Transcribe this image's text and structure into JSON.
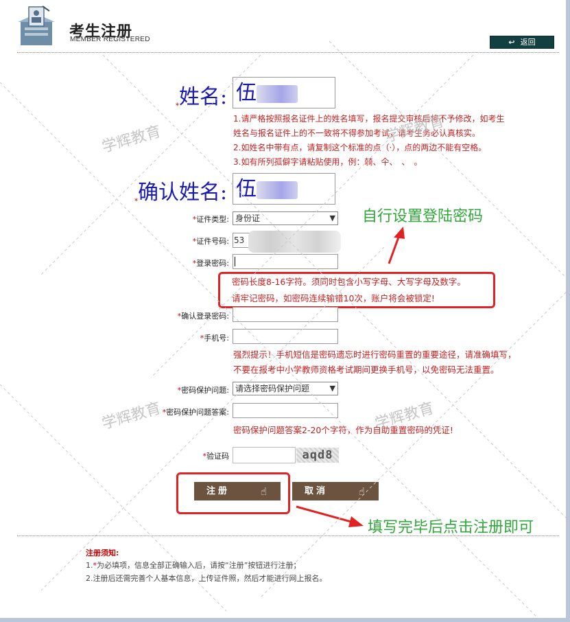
{
  "header": {
    "title": "考生注册",
    "subtitle": "MEMBER REGISTERED",
    "back_label": "返回"
  },
  "form": {
    "name_label": "姓名:",
    "name_value": "伍",
    "confirm_name_label": "确认姓名:",
    "confirm_name_value": "伍",
    "name_notes": [
      "1.请严格按照报名证件上的姓名填写，报名提交审核后将不予修改，如考生",
      "姓名与报名证件上的不一致将不得参加考试，请考生务必认真核实。",
      "2.如姓名中带有点，请复制这个标准的点（·），点的两边不能有空格。",
      "3.如有所列孤僻字请粘贴使用，例：㚡、仐、　、　。"
    ],
    "id_type_label": "证件类型:",
    "id_type_value": "身份证",
    "id_number_label": "证件号码:",
    "id_number_value": "53",
    "password_label": "登录密码:",
    "password_notes": [
      "密码长度8-16字符。须同时包含小写字母、大写字母及数字。",
      "请牢记密码，如密码连续输错10次，账户将会被锁定!"
    ],
    "confirm_password_label": "确认登录密码:",
    "phone_label": "手机号:",
    "phone_notes": [
      "强烈提示！手机短信是密码遗忘时进行密码重置的重要途径，请准确填写，",
      "不要在报考中小学教师资格考试期间更换手机号，以免密码无法重置。"
    ],
    "security_question_label": "密码保护问题:",
    "security_question_value": "请选择密码保护问题",
    "security_answer_label": "密码保护问题答案:",
    "security_answer_note": "密码保护问题答案2-20个字符，作为自助重置密码的凭证!",
    "captcha_label": "验证码",
    "captcha_text": "aqd8",
    "required_mark": "*"
  },
  "buttons": {
    "register": "注册",
    "cancel": "取消"
  },
  "annotations": {
    "set_password": "自行设置登陆密码",
    "click_register": "填写完毕后点击注册即可",
    "watermark": "学辉教育"
  },
  "notice": {
    "title": "注册须知:",
    "line1_prefix": "1.",
    "line1_star": "*",
    "line1_text": "为必填项，信息全部正确输入后，请按“注册”按钮进行注册；",
    "line2": "2.注册后还需完善个人基本信息，上传证件照，然后才能进行网上报名。"
  },
  "colors": {
    "accent_red": "#e02222",
    "annotation_green": "#2fa83a",
    "button_brown": "#6b5340",
    "back_button": "#123f3f",
    "name_blue": "#1a1ab3"
  }
}
